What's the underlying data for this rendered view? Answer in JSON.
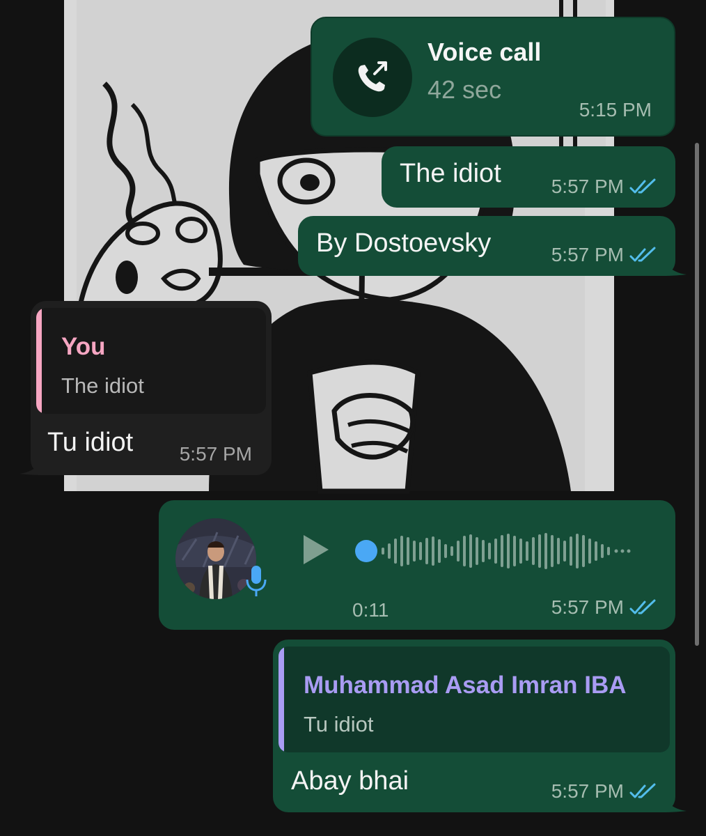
{
  "colors": {
    "outgoing_bubble": "#144d37",
    "incoming_bubble": "#1f1f1f",
    "read_ticks": "#53bdeb",
    "quote_you_name": "#f6a6c2",
    "quote_contact_name": "#a99cf3",
    "accent_blue": "#4aa8f5"
  },
  "voice_call": {
    "title": "Voice call",
    "duration": "42 sec",
    "time": "5:15 PM",
    "icon": "outgoing-call-icon"
  },
  "messages": [
    {
      "text": "The idiot",
      "time": "5:57 PM",
      "status": "read"
    },
    {
      "text": "By Dostoevsky",
      "time": "5:57 PM",
      "status": "read"
    }
  ],
  "incoming_reply": {
    "quote_name": "You",
    "quote_text": "The idiot",
    "text": "Tu idiot",
    "time": "5:57 PM"
  },
  "voice_note": {
    "duration": "0:11",
    "time": "5:57 PM",
    "status": "read",
    "progress": 0,
    "icons": [
      "play-icon",
      "mic-icon"
    ]
  },
  "outgoing_reply": {
    "quote_name": "Muhammad Asad Imran IBA",
    "quote_text": "Tu idiot",
    "text": "Abay bhai",
    "time": "5:57 PM",
    "status": "read"
  }
}
